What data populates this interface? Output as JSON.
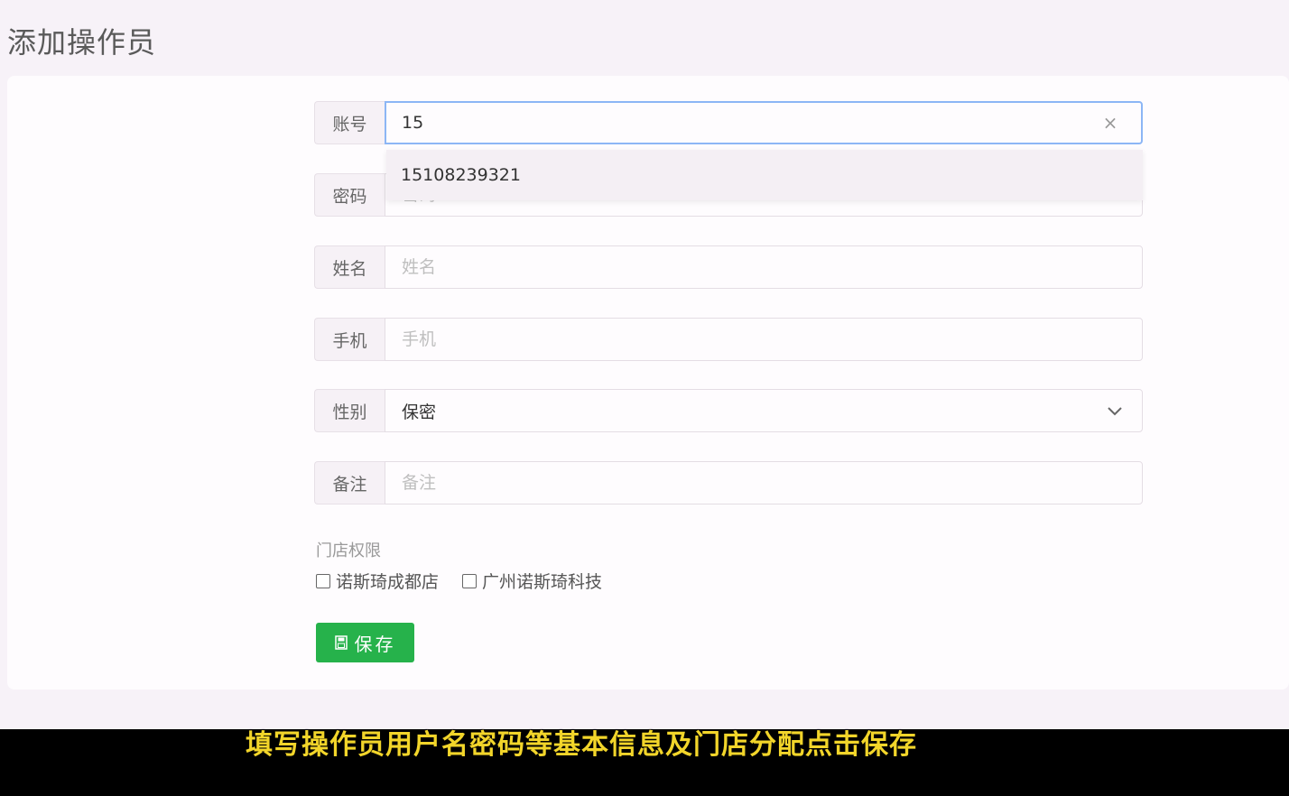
{
  "page": {
    "title": "添加操作员"
  },
  "form": {
    "account": {
      "label": "账号",
      "value": "15"
    },
    "password": {
      "label": "密码",
      "placeholder": "密码"
    },
    "name": {
      "label": "姓名",
      "placeholder": "姓名"
    },
    "phone": {
      "label": "手机",
      "placeholder": "手机"
    },
    "gender": {
      "label": "性别",
      "value": "保密"
    },
    "remark": {
      "label": "备注",
      "placeholder": "备注"
    },
    "autocomplete": [
      "15108239321"
    ],
    "store_permissions": {
      "label": "门店权限",
      "stores": [
        {
          "name": "诺斯琦成都店",
          "checked": false
        },
        {
          "name": "广州诺斯琦科技",
          "checked": false
        }
      ]
    },
    "save_label": "保存"
  },
  "icons": {
    "clear": "close-icon",
    "select": "chevron-down-icon",
    "save": "save-icon"
  },
  "colors": {
    "save_button": "#26b24b",
    "focus_border": "#8cb6f5",
    "subtitle": "#f2d52a"
  },
  "subtitle": "填写操作员用户名密码等基本信息及门店分配点击保存"
}
